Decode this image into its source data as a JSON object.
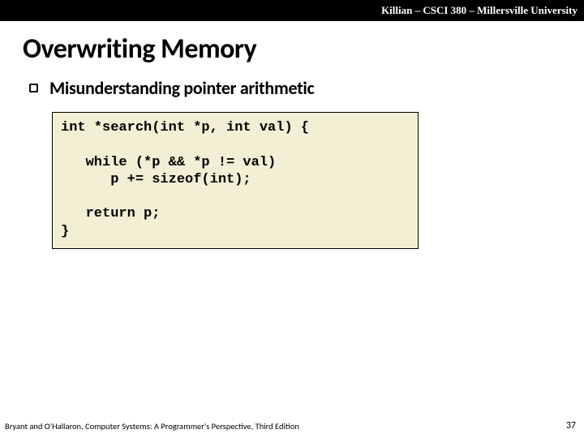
{
  "header": {
    "right_text": "Killian – CSCI 380 – Millersville University"
  },
  "title": "Overwriting Memory",
  "bullet": {
    "text": "Misunderstanding pointer arithmetic"
  },
  "code": "int *search(int *p, int val) {\n\n   while (*p && *p != val)\n      p += sizeof(int);\n\n   return p;\n}",
  "footer": "Bryant and O'Hallaron, Computer Systems: A Programmer's Perspective, Third Edition",
  "page_number": "37"
}
